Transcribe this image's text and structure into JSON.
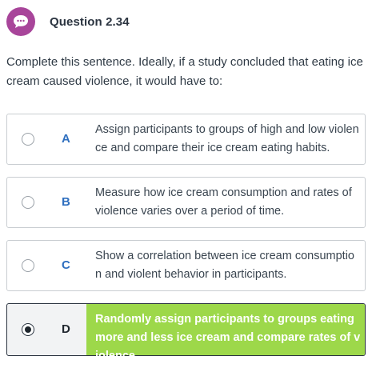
{
  "header": {
    "title": "Question 2.34",
    "icon": "speech-bubble-icon",
    "icon_color": "#a8459a"
  },
  "prompt": "Complete this sentence. Ideally, if a study concluded that eating ice cream caused violence, it would have to:",
  "options": [
    {
      "letter": "A",
      "text": "Assign participants to groups of high and low violence and compare their ice cream eating habits.",
      "selected": false
    },
    {
      "letter": "B",
      "text": "Measure how ice cream consumption and rates of violence varies over a period of time.",
      "selected": false
    },
    {
      "letter": "C",
      "text": "Show a correlation between ice cream consumption and violent behavior in participants.",
      "selected": false
    },
    {
      "letter": "D",
      "text": "Randomly assign participants to groups eating more and less ice cream and compare rates of violence.",
      "selected": true
    }
  ],
  "colors": {
    "letter": "#2f6fbf",
    "selected_panel": "#9dd84a",
    "border": "#c9cdd1"
  }
}
